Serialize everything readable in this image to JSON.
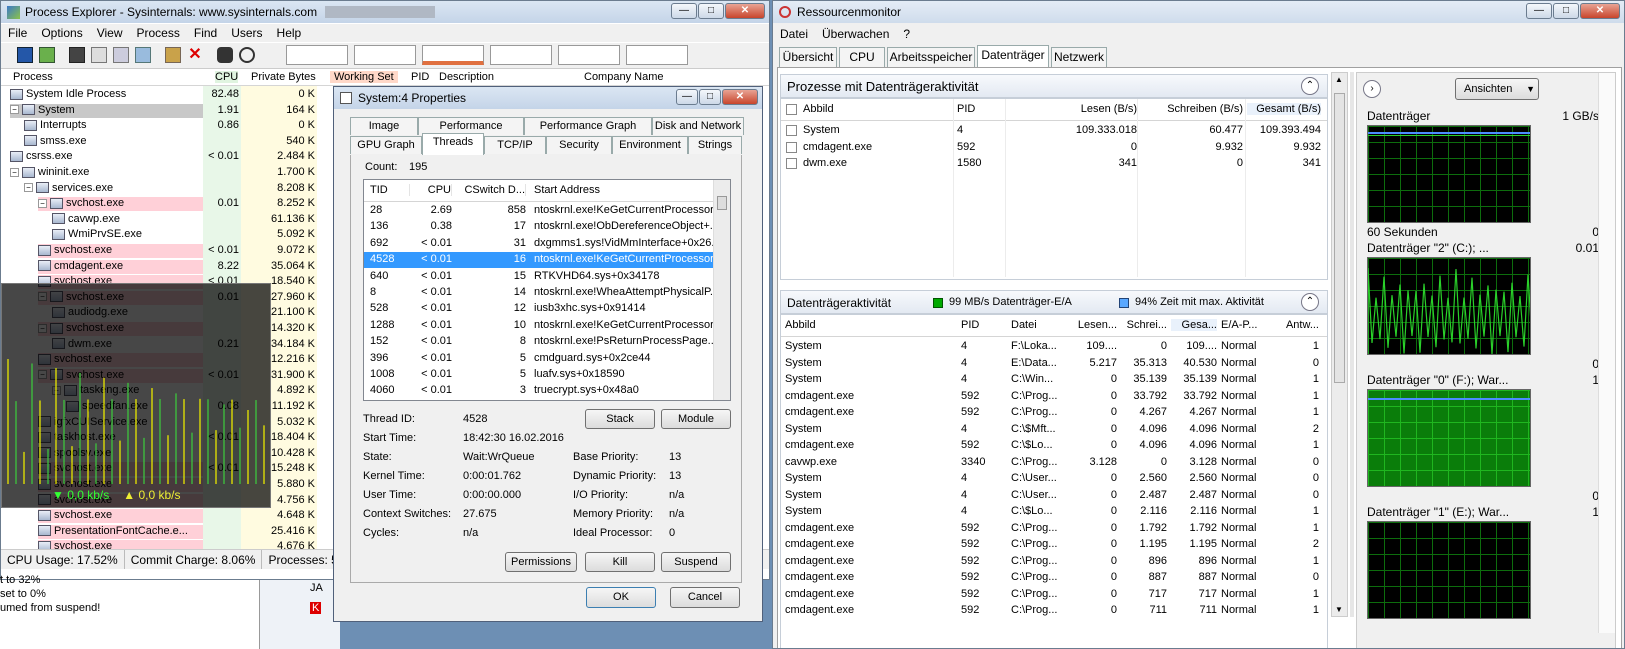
{
  "pe": {
    "title": "Process Explorer - Sysinternals: www.sysinternals.com",
    "menu": [
      "File",
      "Options",
      "View",
      "Process",
      "Find",
      "Users",
      "Help"
    ],
    "cols": [
      "Process",
      "CPU",
      "Private Bytes",
      "Working Set",
      "PID",
      "Description",
      "Company Name"
    ],
    "rows": [
      {
        "indent": 1,
        "tv": "",
        "name": "System Idle Process",
        "cpu": "82.48",
        "pb": "0 K",
        "bg": ""
      },
      {
        "indent": 1,
        "tv": "−",
        "name": "System",
        "cpu": "1.91",
        "pb": "164 K",
        "bg": "#c8c8c8"
      },
      {
        "indent": 3,
        "tv": "",
        "name": "Interrupts",
        "cpu": "0.86",
        "pb": "0 K",
        "bg": ""
      },
      {
        "indent": 3,
        "tv": "",
        "name": "smss.exe",
        "cpu": "",
        "pb": "540 K",
        "bg": ""
      },
      {
        "indent": 1,
        "tv": "",
        "name": "csrss.exe",
        "cpu": "< 0.01",
        "pb": "2.484 K",
        "bg": ""
      },
      {
        "indent": 1,
        "tv": "−",
        "name": "wininit.exe",
        "cpu": "",
        "pb": "1.700 K",
        "bg": ""
      },
      {
        "indent": 3,
        "tv": "−",
        "name": "services.exe",
        "cpu": "",
        "pb": "8.208 K",
        "bg": ""
      },
      {
        "indent": 5,
        "tv": "−",
        "name": "svchost.exe",
        "cpu": "0.01",
        "pb": "8.252 K",
        "bg": "#ffd0d8"
      },
      {
        "indent": 7,
        "tv": "",
        "name": "cavwp.exe",
        "cpu": "",
        "pb": "61.136 K",
        "bg": ""
      },
      {
        "indent": 7,
        "tv": "",
        "name": "WmiPrvSE.exe",
        "cpu": "",
        "pb": "5.092 K",
        "bg": ""
      },
      {
        "indent": 5,
        "tv": "",
        "name": "svchost.exe",
        "cpu": "< 0.01",
        "pb": "9.072 K",
        "bg": "#ffd0d8"
      },
      {
        "indent": 5,
        "tv": "",
        "name": "cmdagent.exe",
        "cpu": "8.22",
        "pb": "35.064 K",
        "bg": "#ffd0d8"
      },
      {
        "indent": 5,
        "tv": "",
        "name": "svchost.exe",
        "cpu": "< 0.01",
        "pb": "18.540 K",
        "bg": "#ffd0d8"
      },
      {
        "indent": 5,
        "tv": "−",
        "name": "svchost.exe",
        "cpu": "0.01",
        "pb": "27.960 K",
        "bg": "#ffd0d8"
      },
      {
        "indent": 7,
        "tv": "",
        "name": "audiodg.exe",
        "cpu": "",
        "pb": "21.100 K",
        "bg": ""
      },
      {
        "indent": 5,
        "tv": "−",
        "name": "svchost.exe",
        "cpu": "",
        "pb": "14.320 K",
        "bg": "#ffd0d8"
      },
      {
        "indent": 7,
        "tv": "",
        "name": "dwm.exe",
        "cpu": "0.21",
        "pb": "34.184 K",
        "bg": ""
      },
      {
        "indent": 5,
        "tv": "",
        "name": "svchost.exe",
        "cpu": "",
        "pb": "12.216 K",
        "bg": "#ffd0d8"
      },
      {
        "indent": 5,
        "tv": "−",
        "name": "svchost.exe",
        "cpu": "< 0.01",
        "pb": "31.900 K",
        "bg": "#ffd0d8"
      },
      {
        "indent": 7,
        "tv": "−",
        "name": "taskeng.exe",
        "cpu": "",
        "pb": "4.892 K",
        "bg": ""
      },
      {
        "indent": 9,
        "tv": "",
        "name": "speedfan.exe",
        "cpu": "0.08",
        "pb": "11.192 K",
        "bg": ""
      },
      {
        "indent": 5,
        "tv": "",
        "name": "igfxCUIService.exe",
        "cpu": "",
        "pb": "5.032 K",
        "bg": ""
      },
      {
        "indent": 5,
        "tv": "",
        "name": "taskhost.exe",
        "cpu": "< 0.01",
        "pb": "18.404 K",
        "bg": ""
      },
      {
        "indent": 5,
        "tv": "",
        "name": "spoolsv.exe",
        "cpu": "",
        "pb": "10.428 K",
        "bg": ""
      },
      {
        "indent": 5,
        "tv": "",
        "name": "svchost.exe",
        "cpu": "< 0.01",
        "pb": "15.248 K",
        "bg": "#ffd0d8"
      },
      {
        "indent": 5,
        "tv": "",
        "name": "svchost.exe",
        "cpu": "",
        "pb": "5.880 K",
        "bg": "#ffd0d8"
      },
      {
        "indent": 5,
        "tv": "",
        "name": "svchost.exe",
        "cpu": "",
        "pb": "4.756 K",
        "bg": "#ffd0d8"
      },
      {
        "indent": 5,
        "tv": "",
        "name": "svchost.exe",
        "cpu": "",
        "pb": "4.648 K",
        "bg": "#ffd0d8"
      },
      {
        "indent": 5,
        "tv": "",
        "name": "PresentationFontCache.e...",
        "cpu": "",
        "pb": "25.416 K",
        "bg": "#ffd0d8"
      },
      {
        "indent": 5,
        "tv": "",
        "name": "svchost.exe",
        "cpu": "",
        "pb": "4.676 K",
        "bg": "#ffd0d8"
      }
    ],
    "status": {
      "cpu": "CPU Usage: 17.52%",
      "commit": "Commit Charge: 8.06%",
      "procs": "Processes: 57"
    },
    "overlay": {
      "down": "▼ 0,0 kb/s",
      "up": "▲ 0,0 kb/s"
    },
    "below": [
      "t to 32%",
      "set to 0%",
      "umed from suspend!"
    ],
    "taskbar": [
      "JA",
      "K"
    ]
  },
  "props": {
    "title": "System:4 Properties",
    "tabs_row1": [
      "Image",
      "Performance",
      "Performance Graph",
      "Disk and Network"
    ],
    "tabs_row2": [
      "GPU Graph",
      "Threads",
      "TCP/IP",
      "Security",
      "Environment",
      "Strings"
    ],
    "count_label": "Count:",
    "count": "195",
    "cols": [
      "TID",
      "CPU",
      "CSwitch D...",
      "Start Address"
    ],
    "threads": [
      [
        "28",
        "2.69",
        "858",
        "ntoskrnl.exe!KeGetCurrentProcessor..."
      ],
      [
        "136",
        "0.38",
        "17",
        "ntoskrnl.exe!ObDereferenceObject+..."
      ],
      [
        "692",
        "< 0.01",
        "31",
        "dxgmms1.sys!VidMmInterface+0x26..."
      ],
      [
        "4528",
        "< 0.01",
        "16",
        "ntoskrnl.exe!KeGetCurrentProcessor..."
      ],
      [
        "640",
        "< 0.01",
        "15",
        "RTKVHD64.sys+0x34178"
      ],
      [
        "8",
        "< 0.01",
        "14",
        "ntoskrnl.exe!WheaAttemptPhysicalP..."
      ],
      [
        "528",
        "< 0.01",
        "12",
        "iusb3xhc.sys+0x91414"
      ],
      [
        "1288",
        "< 0.01",
        "10",
        "ntoskrnl.exe!KeGetCurrentProcessor..."
      ],
      [
        "152",
        "< 0.01",
        "8",
        "ntoskrnl.exe!PsReturnProcessPage..."
      ],
      [
        "396",
        "< 0.01",
        "5",
        "cmdguard.sys+0x2ce44"
      ],
      [
        "1008",
        "< 0.01",
        "5",
        "luafv.sys+0x18590"
      ],
      [
        "4060",
        "< 0.01",
        "3",
        "truecrypt.sys+0x48a0"
      ]
    ],
    "selected": 3,
    "details_left": [
      [
        "Thread ID:",
        "4528"
      ],
      [
        "Start Time:",
        "18:42:30   16.02.2016"
      ],
      [
        "State:",
        "Wait:WrQueue"
      ],
      [
        "Kernel Time:",
        "0:00:01.762"
      ],
      [
        "User Time:",
        "0:00:00.000"
      ],
      [
        "Context Switches:",
        "27.675"
      ],
      [
        "Cycles:",
        "n/a"
      ]
    ],
    "details_right": [
      [
        "Base Priority:",
        "13"
      ],
      [
        "Dynamic Priority:",
        "13"
      ],
      [
        "I/O Priority:",
        "n/a"
      ],
      [
        "Memory Priority:",
        "n/a"
      ],
      [
        "Ideal Processor:",
        "0"
      ]
    ],
    "stack": "Stack",
    "module": "Module",
    "permissions": "Permissions",
    "kill": "Kill",
    "suspend": "Suspend",
    "ok": "OK",
    "cancel": "Cancel"
  },
  "rm": {
    "title": "Ressourcenmonitor",
    "menu": [
      "Datei",
      "Überwachen",
      "?"
    ],
    "tabs": [
      "Übersicht",
      "CPU",
      "Arbeitsspeicher",
      "Datenträger",
      "Netzwerk"
    ],
    "selected_tab": 3,
    "p1_title": "Prozesse mit Datenträgeraktivität",
    "p1_cols": [
      "Abbild",
      "PID",
      "Lesen (B/s)",
      "Schreiben (B/s)",
      "Gesamt (B/s)"
    ],
    "p1_rows": [
      [
        "System",
        "4",
        "109.333.018",
        "60.477",
        "109.393.494"
      ],
      [
        "cmdagent.exe",
        "592",
        "0",
        "9.932",
        "9.932"
      ],
      [
        "dwm.exe",
        "1580",
        "341",
        "0",
        "341"
      ]
    ],
    "p2_title": "Datenträgeraktivität",
    "p2_io": "99 MB/s Datenträger-E/A",
    "p2_act": "94% Zeit mit max. Aktivität",
    "p2_cols": [
      "Abbild",
      "PID",
      "Datei",
      "Lesen...",
      "Schrei...",
      "Gesa...",
      "E/A-P...",
      "Antw..."
    ],
    "p2_rows": [
      [
        "System",
        "4",
        "F:\\Loka...",
        "109....",
        "0",
        "109....",
        "Normal",
        "1"
      ],
      [
        "System",
        "4",
        "E:\\Data...",
        "5.217",
        "35.313",
        "40.530",
        "Normal",
        "0"
      ],
      [
        "System",
        "4",
        "C:\\Win...",
        "0",
        "35.139",
        "35.139",
        "Normal",
        "1"
      ],
      [
        "cmdagent.exe",
        "592",
        "C:\\Prog...",
        "0",
        "33.792",
        "33.792",
        "Normal",
        "1"
      ],
      [
        "cmdagent.exe",
        "592",
        "C:\\Prog...",
        "0",
        "4.267",
        "4.267",
        "Normal",
        "1"
      ],
      [
        "System",
        "4",
        "C:\\$Mft...",
        "0",
        "4.096",
        "4.096",
        "Normal",
        "2"
      ],
      [
        "cmdagent.exe",
        "592",
        "C:\\$Lo...",
        "0",
        "4.096",
        "4.096",
        "Normal",
        "1"
      ],
      [
        "cavwp.exe",
        "3340",
        "C:\\Prog...",
        "3.128",
        "0",
        "3.128",
        "Normal",
        "0"
      ],
      [
        "System",
        "4",
        "C:\\User...",
        "0",
        "2.560",
        "2.560",
        "Normal",
        "0"
      ],
      [
        "System",
        "4",
        "C:\\User...",
        "0",
        "2.487",
        "2.487",
        "Normal",
        "0"
      ],
      [
        "System",
        "4",
        "C:\\$Lo...",
        "0",
        "2.116",
        "2.116",
        "Normal",
        "1"
      ],
      [
        "cmdagent.exe",
        "592",
        "C:\\Prog...",
        "0",
        "1.792",
        "1.792",
        "Normal",
        "1"
      ],
      [
        "cmdagent.exe",
        "592",
        "C:\\Prog...",
        "0",
        "1.195",
        "1.195",
        "Normal",
        "2"
      ],
      [
        "cmdagent.exe",
        "592",
        "C:\\Prog...",
        "0",
        "896",
        "896",
        "Normal",
        "1"
      ],
      [
        "cmdagent.exe",
        "592",
        "C:\\Prog...",
        "0",
        "887",
        "887",
        "Normal",
        "0"
      ],
      [
        "cmdagent.exe",
        "592",
        "C:\\Prog...",
        "0",
        "717",
        "717",
        "Normal",
        "1"
      ],
      [
        "cmdagent.exe",
        "592",
        "C:\\Prog...",
        "0",
        "711",
        "711",
        "Normal",
        "1"
      ]
    ],
    "ansichten": "Ansichten",
    "graphs": [
      {
        "label": "Datenträger",
        "right": "1 GB/s",
        "bottom_left": "60 Sekunden",
        "bottom_right": "0",
        "kind": "flat"
      },
      {
        "label": "Datenträger \"2\" (C:); ...",
        "right": "0.01",
        "bottom_left": "",
        "bottom_right": "0",
        "kind": "spiky"
      },
      {
        "label": "Datenträger \"0\" (F:); War...",
        "right": "1",
        "bottom_left": "",
        "bottom_right": "0",
        "kind": "full"
      },
      {
        "label": "Datenträger \"1\" (E:); War...",
        "right": "1",
        "bottom_left": "",
        "bottom_right": "",
        "kind": "empty"
      }
    ]
  }
}
